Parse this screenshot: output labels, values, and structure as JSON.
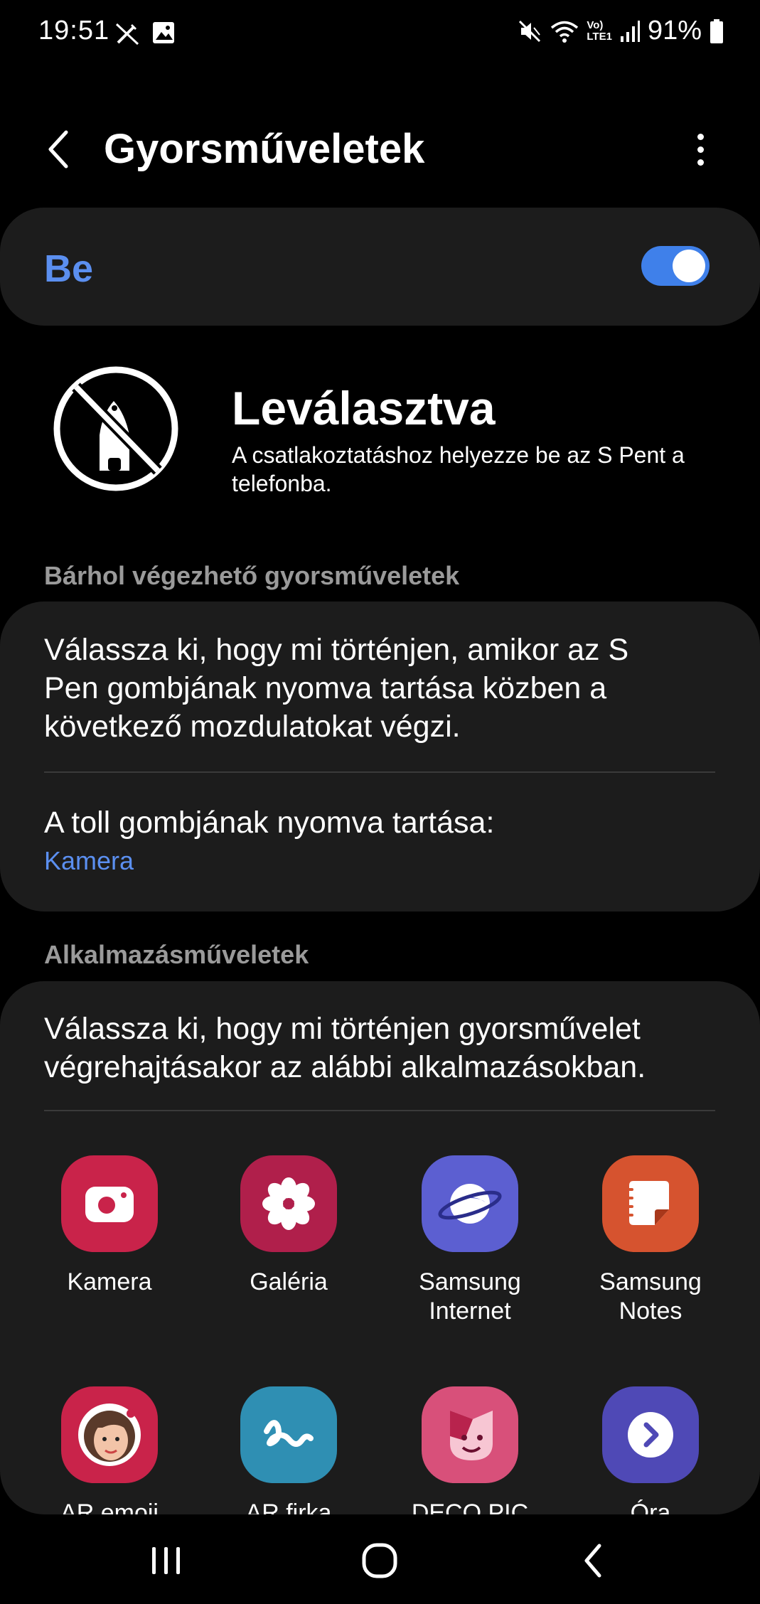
{
  "status_bar": {
    "time": "19:51",
    "battery": "91%",
    "icons": [
      "no-pen-icon",
      "image-icon",
      "mute-icon",
      "wifi-icon",
      "volte-icon",
      "signal-icon",
      "battery-icon"
    ],
    "volte_line1": "Vo)",
    "volte_line2": "LTE1"
  },
  "header": {
    "title": "Gyorsműveletek"
  },
  "master_switch": {
    "label": "Be",
    "state": "on",
    "accent": "#3f80ea"
  },
  "pen_status": {
    "title": "Leválasztva",
    "description": "A csatlakoztatáshoz helyezze be az S Pent a telefonba."
  },
  "anywhere_actions": {
    "section_title": "Bárhol végezhető gyorsműveletek",
    "description": "Válassza ki, hogy mi történjen, amikor az S Pen gombjának nyomva tartása közben a következő mozdulatokat végzi.",
    "hold_label": "A toll gombjának nyomva tartása:",
    "hold_value": "Kamera"
  },
  "app_actions": {
    "section_title": "Alkalmazásműveletek",
    "description": "Válassza ki, hogy mi történjen gyorsművelet végrehajtásakor az alábbi alkalmazásokban.",
    "apps": [
      {
        "label": "Kamera",
        "icon": "camera-icon",
        "color": "#c9234a"
      },
      {
        "label": "Galéria",
        "icon": "flower-icon",
        "color": "#b01f4b"
      },
      {
        "label": "Samsung Internet",
        "icon": "planet-icon",
        "color": "#5c5fd1"
      },
      {
        "label": "Samsung Notes",
        "icon": "notes-icon",
        "color": "#d6532f"
      },
      {
        "label": "AR emoji",
        "icon": "ar-emoji-icon",
        "color": "#c9234a"
      },
      {
        "label": "AR firka",
        "icon": "ar-doodle-icon",
        "color": "#2f8fb3"
      },
      {
        "label": "DECO PIC",
        "icon": "deco-pic-icon",
        "color": "#d8507a"
      },
      {
        "label": "Óra",
        "icon": "clock-icon",
        "color": "#4f49b6"
      }
    ]
  },
  "nav_bar": {
    "buttons": [
      "recents-icon",
      "home-icon",
      "back-nav-icon"
    ]
  }
}
